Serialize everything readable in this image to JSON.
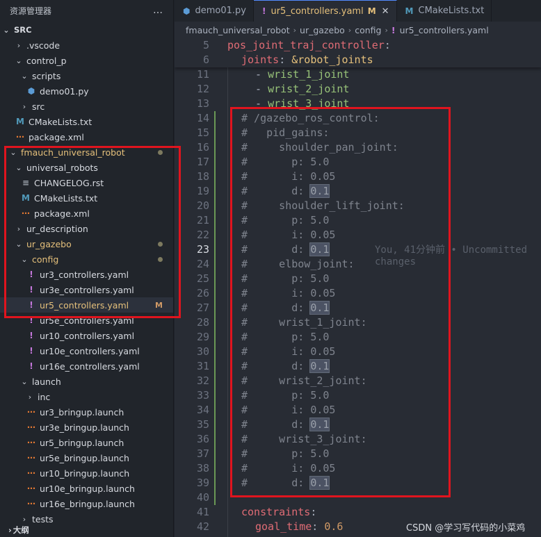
{
  "sidebar": {
    "title": "资源管理器",
    "more_icon": "…",
    "section_label": "SRC",
    "outline_label": "大纲",
    "items": [
      {
        "label": ".vscode",
        "kind": "folder-closed"
      },
      {
        "label": "control_p",
        "kind": "folder-open"
      },
      {
        "label": "scripts",
        "kind": "folder-open"
      },
      {
        "label": "demo01.py",
        "kind": "py"
      },
      {
        "label": "src",
        "kind": "folder-closed"
      },
      {
        "label": "CMakeLists.txt",
        "kind": "cmake"
      },
      {
        "label": "package.xml",
        "kind": "xml"
      },
      {
        "label": "fmauch_universal_robot",
        "kind": "folder-open",
        "status": "dot"
      },
      {
        "label": "universal_robots",
        "kind": "folder-open"
      },
      {
        "label": "CHANGELOG.rst",
        "kind": "rst"
      },
      {
        "label": "CMakeLists.txt",
        "kind": "cmake"
      },
      {
        "label": "package.xml",
        "kind": "xml"
      },
      {
        "label": "ur_description",
        "kind": "folder-closed"
      },
      {
        "label": "ur_gazebo",
        "kind": "folder-open",
        "status": "dot"
      },
      {
        "label": "config",
        "kind": "folder-open",
        "status": "dot"
      },
      {
        "label": "ur3_controllers.yaml",
        "kind": "yaml"
      },
      {
        "label": "ur3e_controllers.yaml",
        "kind": "yaml"
      },
      {
        "label": "ur5_controllers.yaml",
        "kind": "yaml",
        "status": "M"
      },
      {
        "label": "ur5e_controllers.yaml",
        "kind": "yaml"
      },
      {
        "label": "ur10_controllers.yaml",
        "kind": "yaml"
      },
      {
        "label": "ur10e_controllers.yaml",
        "kind": "yaml"
      },
      {
        "label": "ur16e_controllers.yaml",
        "kind": "yaml"
      },
      {
        "label": "launch",
        "kind": "folder-open"
      },
      {
        "label": "inc",
        "kind": "folder-closed"
      },
      {
        "label": "ur3_bringup.launch",
        "kind": "launch"
      },
      {
        "label": "ur3e_bringup.launch",
        "kind": "launch"
      },
      {
        "label": "ur5_bringup.launch",
        "kind": "launch"
      },
      {
        "label": "ur5e_bringup.launch",
        "kind": "launch"
      },
      {
        "label": "ur10_bringup.launch",
        "kind": "launch"
      },
      {
        "label": "ur10e_bringup.launch",
        "kind": "launch"
      },
      {
        "label": "ur16e_bringup.launch",
        "kind": "launch"
      },
      {
        "label": "tests",
        "kind": "folder-closed"
      }
    ]
  },
  "tabs": [
    {
      "label": "demo01.py",
      "icon": "python-icon"
    },
    {
      "label": "ur5_controllers.yaml",
      "icon": "yaml-icon",
      "modified": "M",
      "close": "✕"
    },
    {
      "label": "CMakeLists.txt",
      "icon": "cmake-icon"
    }
  ],
  "breadcrumb": [
    "fmauch_universal_robot",
    "ur_gazebo",
    "config",
    "ur5_controllers.yaml"
  ],
  "editor": {
    "sticky": [
      {
        "n": "5",
        "key": "pos_joint_traj_controller",
        "punc": ":"
      },
      {
        "n": "6",
        "key": "joints",
        "punc": ": ",
        "anchor": "&robot_joints"
      }
    ],
    "list_lines": [
      {
        "n": "11",
        "dash": "- ",
        "value": "wrist_1_joint"
      },
      {
        "n": "12",
        "dash": "- ",
        "value": "wrist_2_joint"
      },
      {
        "n": "13",
        "dash": "- ",
        "value": "wrist_3_joint"
      }
    ],
    "comment_lines": [
      {
        "n": "14",
        "text": "# /gazebo_ros_control:"
      },
      {
        "n": "15",
        "text": "#   pid_gains:"
      },
      {
        "n": "16",
        "text": "#     shoulder_pan_joint:"
      },
      {
        "n": "17",
        "text": "#       p: 5.0"
      },
      {
        "n": "18",
        "text": "#       i: 0.05"
      },
      {
        "n": "19",
        "text": "#       d: ",
        "hl": "0.1"
      },
      {
        "n": "20",
        "text": "#     shoulder_lift_joint:"
      },
      {
        "n": "21",
        "text": "#       p: 5.0"
      },
      {
        "n": "22",
        "text": "#       i: 0.05"
      },
      {
        "n": "23",
        "text": "#       d: ",
        "hl": "0.1",
        "current": true
      },
      {
        "n": "24",
        "text": "#     elbow_joint:"
      },
      {
        "n": "25",
        "text": "#       p: 5.0"
      },
      {
        "n": "26",
        "text": "#       i: 0.05"
      },
      {
        "n": "27",
        "text": "#       d: ",
        "hl": "0.1"
      },
      {
        "n": "28",
        "text": "#     wrist_1_joint:"
      },
      {
        "n": "29",
        "text": "#       p: 5.0"
      },
      {
        "n": "30",
        "text": "#       i: 0.05"
      },
      {
        "n": "31",
        "text": "#       d: ",
        "hl": "0.1"
      },
      {
        "n": "32",
        "text": "#     wrist_2_joint:"
      },
      {
        "n": "33",
        "text": "#       p: 5.0"
      },
      {
        "n": "34",
        "text": "#       i: 0.05"
      },
      {
        "n": "35",
        "text": "#       d: ",
        "hl": "0.1"
      },
      {
        "n": "36",
        "text": "#     wrist_3_joint:"
      },
      {
        "n": "37",
        "text": "#       p: 5.0"
      },
      {
        "n": "38",
        "text": "#       i: 0.05"
      },
      {
        "n": "39",
        "text": "#       d: ",
        "hl": "0.1"
      }
    ],
    "blank_line": {
      "n": "40"
    },
    "tail_lines": [
      {
        "n": "41",
        "key": "constraints",
        "punc": ":"
      },
      {
        "n": "42",
        "key": "goal_time",
        "punc": ": ",
        "num": "0.6"
      }
    ],
    "blame": "You, 41分钟前 • Uncommitted changes"
  },
  "watermark": "CSDN @学习写代码的小菜鸡",
  "colors": {
    "annotation_red": "#e0141e",
    "yaml_key": "#e06c75",
    "string": "#98c379",
    "comment": "#7f848e",
    "modified": "#e5c07b"
  }
}
